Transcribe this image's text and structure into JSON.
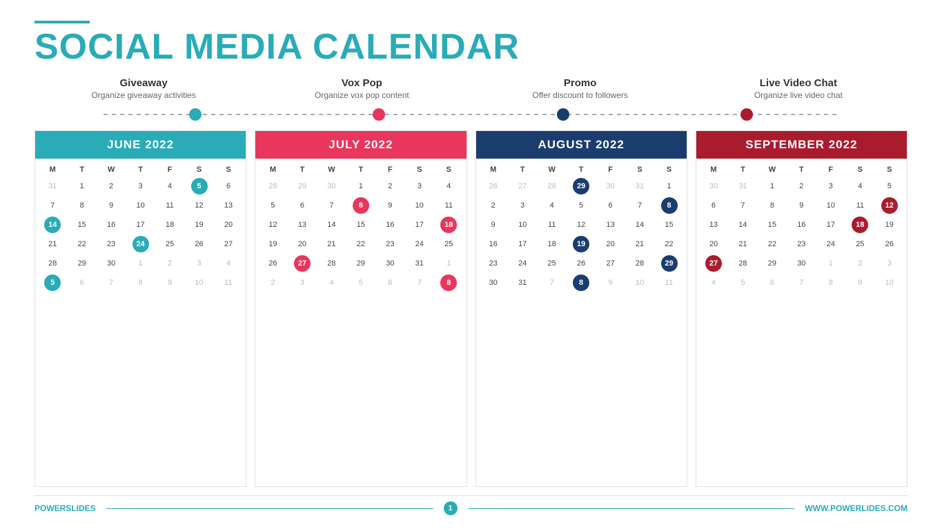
{
  "header": {
    "line_color": "#2AABB8",
    "title_part1": "SOCIAL MEDIA ",
    "title_part2": "CALENDAR"
  },
  "categories": [
    {
      "id": "giveaway",
      "title": "Giveaway",
      "subtitle": "Organize giveaway activities"
    },
    {
      "id": "vox-pop",
      "title": "Vox Pop",
      "subtitle": "Organize vox pop content"
    },
    {
      "id": "promo",
      "title": "Promo",
      "subtitle": "Offer discount to followers"
    },
    {
      "id": "live-video",
      "title": "Live Video Chat",
      "subtitle": "Organize live video chat"
    }
  ],
  "timeline": {
    "dots": [
      "blue",
      "pink",
      "dark-blue",
      "dark-red"
    ]
  },
  "calendars": [
    {
      "id": "june-2022",
      "title": "JUNE 2022",
      "color_class": "cal-blue",
      "days_header": [
        "M",
        "T",
        "W",
        "T",
        "F",
        "S",
        "S"
      ],
      "weeks": [
        [
          "31",
          "1",
          "2",
          "3",
          "4",
          "5",
          "6"
        ],
        [
          "7",
          "8",
          "9",
          "10",
          "11",
          "12",
          "13"
        ],
        [
          "14",
          "15",
          "16",
          "17",
          "18",
          "19",
          "20"
        ],
        [
          "21",
          "22",
          "23",
          "24",
          "25",
          "26",
          "27"
        ],
        [
          "28",
          "29",
          "30",
          "1",
          "2",
          "3",
          "4"
        ],
        [
          "5",
          "6",
          "7",
          "8",
          "9",
          "10",
          "11"
        ]
      ],
      "highlights_blue": [
        "5",
        "14",
        "24"
      ],
      "highlights_pink": [],
      "other_month": [
        "31",
        "1",
        "2",
        "3",
        "4",
        "5",
        "6",
        "7",
        "8",
        "9",
        "10",
        "11"
      ]
    },
    {
      "id": "july-2022",
      "title": "JULY 2022",
      "color_class": "cal-pink",
      "days_header": [
        "M",
        "T",
        "W",
        "T",
        "F",
        "S",
        "S"
      ],
      "weeks": [
        [
          "28",
          "29",
          "30",
          "1",
          "2",
          "3",
          "4"
        ],
        [
          "5",
          "6",
          "7",
          "8",
          "9",
          "10",
          "11"
        ],
        [
          "12",
          "13",
          "14",
          "15",
          "16",
          "17",
          "18"
        ],
        [
          "19",
          "20",
          "21",
          "22",
          "23",
          "24",
          "25"
        ],
        [
          "26",
          "27",
          "28",
          "29",
          "30",
          "31",
          "1"
        ],
        [
          "2",
          "3",
          "4",
          "5",
          "6",
          "7",
          "8"
        ]
      ],
      "highlights_blue": [],
      "highlights_pink": [
        "8",
        "18",
        "27"
      ],
      "other_month": [
        "28",
        "29",
        "30",
        "1",
        "2",
        "3",
        "4",
        "5",
        "6",
        "7",
        "8"
      ]
    },
    {
      "id": "august-2022",
      "title": "AUGUST 2022",
      "color_class": "cal-dark-blue",
      "days_header": [
        "M",
        "T",
        "W",
        "T",
        "F",
        "S",
        "S"
      ],
      "weeks": [
        [
          "26",
          "27",
          "28",
          "29",
          "30",
          "31",
          "1"
        ],
        [
          "2",
          "3",
          "4",
          "5",
          "6",
          "7",
          "8"
        ],
        [
          "9",
          "10",
          "11",
          "12",
          "13",
          "14",
          "15"
        ],
        [
          "16",
          "17",
          "18",
          "19",
          "20",
          "21",
          "22"
        ],
        [
          "23",
          "24",
          "25",
          "26",
          "27",
          "28",
          "29"
        ],
        [
          "30",
          "31",
          "7",
          "8",
          "9",
          "10",
          "11"
        ]
      ],
      "highlights_blue": [
        "8",
        "19",
        "29"
      ],
      "highlights_pink": [],
      "other_month": [
        "26",
        "27",
        "28",
        "29",
        "30",
        "31",
        "7",
        "8",
        "9",
        "10",
        "11"
      ]
    },
    {
      "id": "september-2022",
      "title": "SEPTEMBER 2022",
      "color_class": "cal-dark-red",
      "days_header": [
        "M",
        "T",
        "W",
        "T",
        "F",
        "S",
        "S"
      ],
      "weeks": [
        [
          "30",
          "31",
          "1",
          "2",
          "3",
          "4",
          "5"
        ],
        [
          "6",
          "7",
          "8",
          "9",
          "10",
          "11",
          "12"
        ],
        [
          "13",
          "14",
          "15",
          "16",
          "17",
          "18",
          "19"
        ],
        [
          "20",
          "21",
          "22",
          "23",
          "24",
          "25",
          "26"
        ],
        [
          "27",
          "28",
          "29",
          "30",
          "1",
          "2",
          "3"
        ],
        [
          "4",
          "5",
          "6",
          "7",
          "8",
          "9",
          "10"
        ]
      ],
      "highlights_blue": [],
      "highlights_pink": [
        "12",
        "18",
        "27"
      ],
      "other_month": [
        "30",
        "31",
        "1",
        "2",
        "3",
        "4",
        "5",
        "6",
        "7",
        "8",
        "9",
        "10"
      ]
    }
  ],
  "footer": {
    "brand_part1": "POWER",
    "brand_part2": "SLIDES",
    "page_number": "1",
    "website": "WWW.POWERLIDES.COM"
  }
}
